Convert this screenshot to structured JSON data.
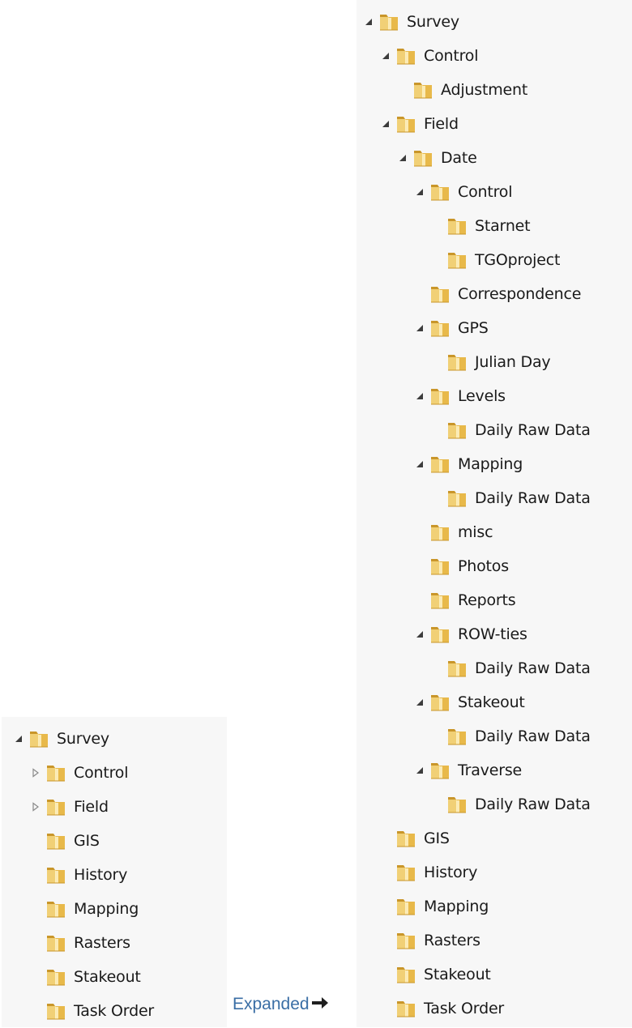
{
  "caption": {
    "text": "Expanded",
    "arrow_icon": "right-arrow-icon"
  },
  "colors": {
    "folder": "#e8b94a",
    "folder_dark": "#c9962a",
    "folder_light": "#f8e39a",
    "arrow_expanded": "#3c3c3c",
    "arrow_collapsed": "#8a8a8a",
    "caption": "#3a6ea5"
  },
  "left_tree": [
    {
      "label": "Survey",
      "depth": 0,
      "expander": "expanded"
    },
    {
      "label": "Control",
      "depth": 1,
      "expander": "collapsed"
    },
    {
      "label": "Field",
      "depth": 1,
      "expander": "collapsed"
    },
    {
      "label": "GIS",
      "depth": 1,
      "expander": "none"
    },
    {
      "label": "History",
      "depth": 1,
      "expander": "none"
    },
    {
      "label": "Mapping",
      "depth": 1,
      "expander": "none"
    },
    {
      "label": "Rasters",
      "depth": 1,
      "expander": "none"
    },
    {
      "label": "Stakeout",
      "depth": 1,
      "expander": "none"
    },
    {
      "label": "Task Order",
      "depth": 1,
      "expander": "none"
    }
  ],
  "right_tree": [
    {
      "label": "Survey",
      "depth": 0,
      "expander": "expanded"
    },
    {
      "label": "Control",
      "depth": 1,
      "expander": "expanded"
    },
    {
      "label": "Adjustment",
      "depth": 2,
      "expander": "none"
    },
    {
      "label": "Field",
      "depth": 1,
      "expander": "expanded"
    },
    {
      "label": "Date",
      "depth": 2,
      "expander": "expanded"
    },
    {
      "label": "Control",
      "depth": 3,
      "expander": "expanded"
    },
    {
      "label": "Starnet",
      "depth": 4,
      "expander": "none"
    },
    {
      "label": "TGOproject",
      "depth": 4,
      "expander": "none"
    },
    {
      "label": "Correspondence",
      "depth": 3,
      "expander": "none"
    },
    {
      "label": "GPS",
      "depth": 3,
      "expander": "expanded"
    },
    {
      "label": "Julian Day",
      "depth": 4,
      "expander": "none"
    },
    {
      "label": "Levels",
      "depth": 3,
      "expander": "expanded"
    },
    {
      "label": "Daily Raw Data",
      "depth": 4,
      "expander": "none"
    },
    {
      "label": "Mapping",
      "depth": 3,
      "expander": "expanded"
    },
    {
      "label": "Daily Raw Data",
      "depth": 4,
      "expander": "none"
    },
    {
      "label": "misc",
      "depth": 3,
      "expander": "none"
    },
    {
      "label": "Photos",
      "depth": 3,
      "expander": "none"
    },
    {
      "label": "Reports",
      "depth": 3,
      "expander": "none"
    },
    {
      "label": "ROW-ties",
      "depth": 3,
      "expander": "expanded"
    },
    {
      "label": "Daily Raw Data",
      "depth": 4,
      "expander": "none"
    },
    {
      "label": "Stakeout",
      "depth": 3,
      "expander": "expanded"
    },
    {
      "label": "Daily Raw Data",
      "depth": 4,
      "expander": "none"
    },
    {
      "label": "Traverse",
      "depth": 3,
      "expander": "expanded"
    },
    {
      "label": "Daily Raw Data",
      "depth": 4,
      "expander": "none"
    },
    {
      "label": "GIS",
      "depth": 1,
      "expander": "none"
    },
    {
      "label": "History",
      "depth": 1,
      "expander": "none"
    },
    {
      "label": "Mapping",
      "depth": 1,
      "expander": "none"
    },
    {
      "label": "Rasters",
      "depth": 1,
      "expander": "none"
    },
    {
      "label": "Stakeout",
      "depth": 1,
      "expander": "none"
    },
    {
      "label": "Task Order",
      "depth": 1,
      "expander": "none"
    }
  ]
}
